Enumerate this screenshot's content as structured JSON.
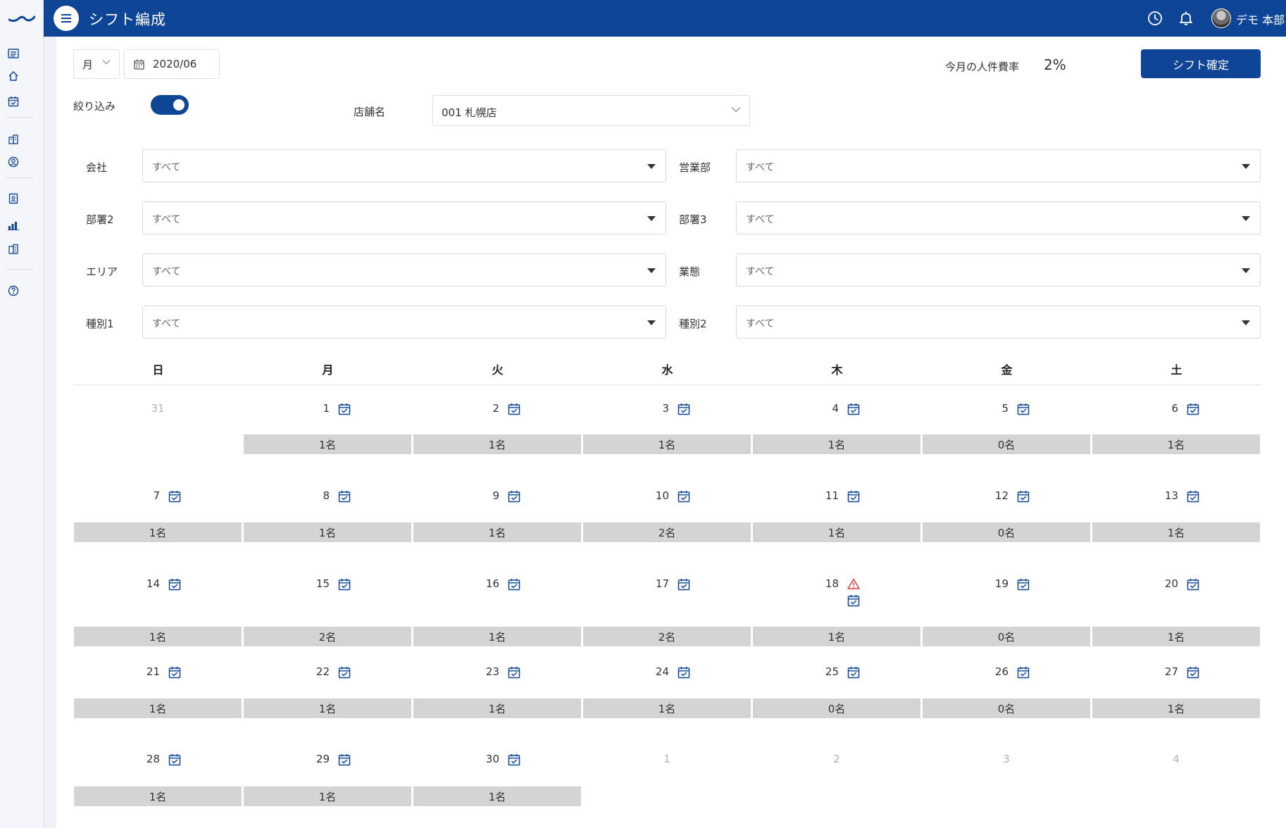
{
  "header": {
    "title": "シフト編成",
    "user_name": "デモ 本部"
  },
  "toolbar": {
    "period_unit": "月",
    "date": "2020/06",
    "labor_cost_label": "今月の人件費率",
    "labor_cost_value": "2%",
    "confirm_label": "シフト確定"
  },
  "filter": {
    "label": "絞り込み",
    "enabled": true,
    "store_label": "店舗名",
    "store_value": "001 札幌店"
  },
  "filters": [
    {
      "label": "会社",
      "value": "すべて"
    },
    {
      "label": "営業部",
      "value": "すべて"
    },
    {
      "label": "部署2",
      "value": "すべて"
    },
    {
      "label": "部署3",
      "value": "すべて"
    },
    {
      "label": "エリア",
      "value": "すべて"
    },
    {
      "label": "業態",
      "value": "すべて"
    },
    {
      "label": "種別1",
      "value": "すべて"
    },
    {
      "label": "種別2",
      "value": "すべて"
    }
  ],
  "calendar": {
    "weekdays": [
      "日",
      "月",
      "火",
      "水",
      "木",
      "金",
      "土"
    ],
    "weeks": [
      [
        {
          "d": "31",
          "out": true
        },
        {
          "d": "1",
          "c": "1名"
        },
        {
          "d": "2",
          "c": "1名"
        },
        {
          "d": "3",
          "c": "1名"
        },
        {
          "d": "4",
          "c": "1名"
        },
        {
          "d": "5",
          "c": "0名"
        },
        {
          "d": "6",
          "c": "1名"
        }
      ],
      [
        {
          "d": "7",
          "c": "1名"
        },
        {
          "d": "8",
          "c": "1名"
        },
        {
          "d": "9",
          "c": "1名"
        },
        {
          "d": "10",
          "c": "2名"
        },
        {
          "d": "11",
          "c": "1名"
        },
        {
          "d": "12",
          "c": "0名"
        },
        {
          "d": "13",
          "c": "1名"
        }
      ],
      [
        {
          "d": "14",
          "c": "1名"
        },
        {
          "d": "15",
          "c": "2名"
        },
        {
          "d": "16",
          "c": "1名"
        },
        {
          "d": "17",
          "c": "2名"
        },
        {
          "d": "18",
          "c": "1名",
          "warn": true
        },
        {
          "d": "19",
          "c": "0名"
        },
        {
          "d": "20",
          "c": "1名"
        }
      ],
      [
        {
          "d": "21",
          "c": "1名"
        },
        {
          "d": "22",
          "c": "1名"
        },
        {
          "d": "23",
          "c": "1名"
        },
        {
          "d": "24",
          "c": "1名"
        },
        {
          "d": "25",
          "c": "0名"
        },
        {
          "d": "26",
          "c": "0名"
        },
        {
          "d": "27",
          "c": "1名"
        }
      ],
      [
        {
          "d": "28",
          "c": "1名"
        },
        {
          "d": "29",
          "c": "1名"
        },
        {
          "d": "30",
          "c": "1名"
        },
        {
          "d": "1",
          "out": true
        },
        {
          "d": "2",
          "out": true
        },
        {
          "d": "3",
          "out": true
        },
        {
          "d": "4",
          "out": true
        }
      ]
    ]
  },
  "colors": {
    "primary": "#0e4596",
    "bar": "#d4d4d4",
    "warning": "#e03c3c"
  },
  "icons": {
    "sidebar": [
      "list-icon",
      "home-icon",
      "calendar-check-icon",
      "building-icon",
      "user-circle-icon",
      "id-badge-icon",
      "bar-chart-icon",
      "office-icon",
      "help-icon"
    ],
    "header": [
      "clock-icon",
      "bell-icon"
    ]
  }
}
